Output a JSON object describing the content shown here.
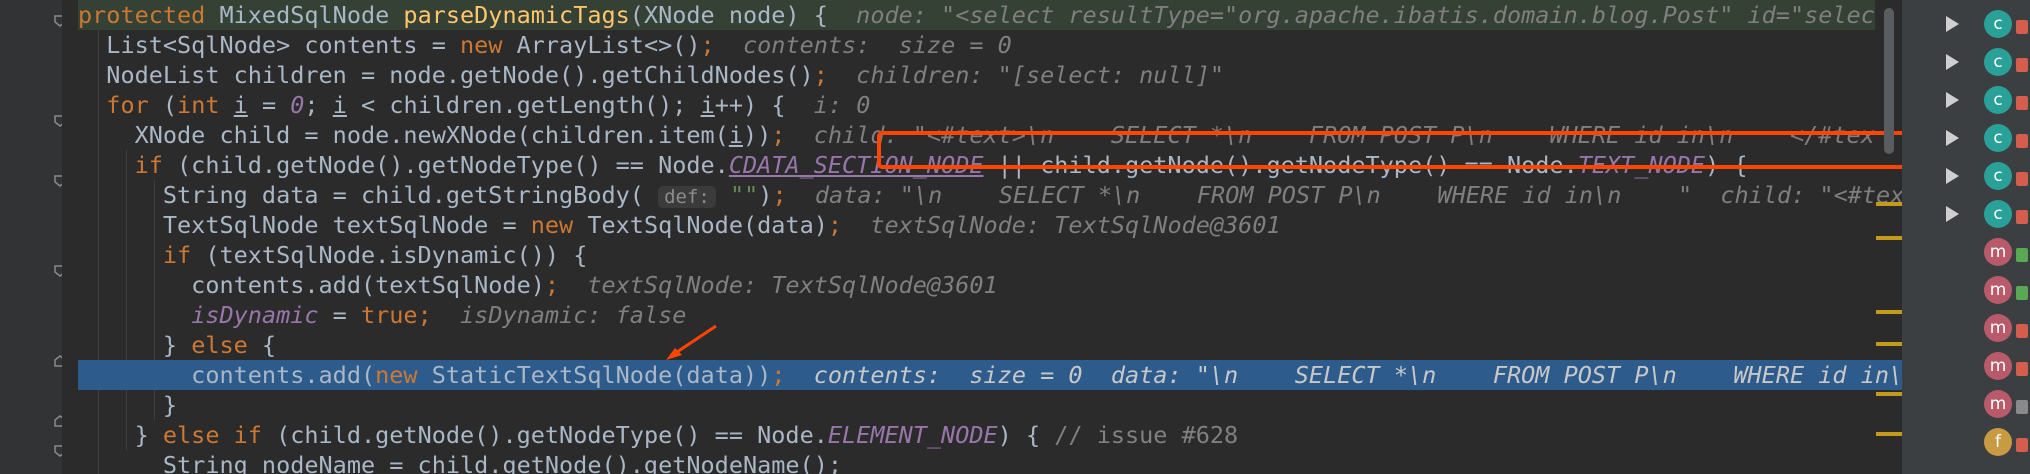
{
  "code_lines": [
    {
      "segments": [
        {
          "text": "protected",
          "cls": "kw"
        },
        {
          "text": " MixedSqlNode "
        },
        {
          "text": "parseDynamicTags",
          "cls": "fn"
        },
        {
          "text": "(XNode node) {  "
        },
        {
          "text": "node: \"<select resultType=\"org.apache.ibatis.domain.blog.Post\" id=\"selec",
          "cls": "hint"
        }
      ]
    },
    {
      "segments": [
        {
          "text": "  List<SqlNode> contents = "
        },
        {
          "text": "new",
          "cls": "kw"
        },
        {
          "text": " ArrayList<>()"
        },
        {
          "text": ";",
          "cls": "kw"
        },
        {
          "text": "  contents:  size = 0",
          "cls": "hint"
        }
      ]
    },
    {
      "segments": [
        {
          "text": "  NodeList children = node.getNode().getChildNodes()"
        },
        {
          "text": ";",
          "cls": "kw"
        },
        {
          "text": "  children: \"[select: null]\"",
          "cls": "hint"
        }
      ]
    },
    {
      "segments": [
        {
          "text": "  "
        },
        {
          "text": "for",
          "cls": "kw"
        },
        {
          "text": " ("
        },
        {
          "text": "int",
          "cls": "kw"
        },
        {
          "text": " "
        },
        {
          "text": "i",
          "cls": "ul"
        },
        {
          "text": " = "
        },
        {
          "text": "0",
          "cls": "cn"
        },
        {
          "text": "; "
        },
        {
          "text": "i",
          "cls": "ul"
        },
        {
          "text": " < children.getLength(); "
        },
        {
          "text": "i",
          "cls": "ul"
        },
        {
          "text": "++) {  "
        },
        {
          "text": "i: 0",
          "cls": "hint"
        }
      ]
    },
    {
      "segments": [
        {
          "text": "    XNode child = node.newXNode(children.item("
        },
        {
          "text": "i",
          "cls": "ul"
        },
        {
          "text": "))"
        },
        {
          "text": ";",
          "cls": "kw"
        },
        {
          "text": "  child: \"<#text>\\n    SELECT *\\n    FROM POST P\\n    WHERE id in\\n    </#tex",
          "cls": "hint"
        }
      ]
    },
    {
      "segments": [
        {
          "text": "    "
        },
        {
          "text": "if",
          "cls": "kw"
        },
        {
          "text": " (child.getNode().getNodeType() == Node."
        },
        {
          "text": "CDATA_SECTION_NODE",
          "cls": "cn ul"
        },
        {
          "text": " || child.getNode().getNodeType() == Node."
        },
        {
          "text": "TEXT_NODE",
          "cls": "cn"
        },
        {
          "text": ") {"
        }
      ]
    },
    {
      "segments": [
        {
          "text": "      String data = child.getStringBody( "
        },
        {
          "text": "def:",
          "cls": "param-hint"
        },
        {
          "text": " "
        },
        {
          "text": "\"\"",
          "cls": "str"
        },
        {
          "text": ")"
        },
        {
          "text": ";",
          "cls": "kw"
        },
        {
          "text": "  data: \"\\n    SELECT *\\n    FROM POST P\\n    WHERE id in\\n    \"  child: \"<#text",
          "cls": "hint"
        }
      ]
    },
    {
      "segments": [
        {
          "text": "      TextSqlNode textSqlNode = "
        },
        {
          "text": "new",
          "cls": "kw"
        },
        {
          "text": " TextSqlNode(data)"
        },
        {
          "text": ";",
          "cls": "kw"
        },
        {
          "text": "  textSqlNode: TextSqlNode@3601",
          "cls": "hint"
        }
      ]
    },
    {
      "segments": [
        {
          "text": "      "
        },
        {
          "text": "if",
          "cls": "kw"
        },
        {
          "text": " (textSqlNode.isDynamic()) {"
        }
      ]
    },
    {
      "segments": [
        {
          "text": "        contents.add(textSqlNode)"
        },
        {
          "text": ";",
          "cls": "kw"
        },
        {
          "text": "  textSqlNode: TextSqlNode@3601",
          "cls": "hint"
        }
      ]
    },
    {
      "segments": [
        {
          "text": "        "
        },
        {
          "text": "isDynamic",
          "cls": "cn"
        },
        {
          "text": " = "
        },
        {
          "text": "true",
          "cls": "kw"
        },
        {
          "text": ";",
          "cls": "kw"
        },
        {
          "text": "  isDynamic: false",
          "cls": "hint"
        }
      ]
    },
    {
      "segments": [
        {
          "text": "      } "
        },
        {
          "text": "else",
          "cls": "kw"
        },
        {
          "text": " {"
        }
      ]
    },
    {
      "segments": [
        {
          "text": "        contents.add("
        },
        {
          "text": "new",
          "cls": "kw"
        },
        {
          "text": " StaticTextSqlNode(data))"
        },
        {
          "text": ";",
          "cls": "kw"
        },
        {
          "text": "  contents:  size = 0  data: \"\\n    SELECT *\\n    FROM POST P\\n    WHERE id in\\",
          "cls": "hint"
        }
      ]
    },
    {
      "segments": [
        {
          "text": "      }"
        }
      ]
    },
    {
      "segments": [
        {
          "text": "    } "
        },
        {
          "text": "else if",
          "cls": "kw"
        },
        {
          "text": " (child.getNode().getNodeType() == Node."
        },
        {
          "text": "ELEMENT_NODE",
          "cls": "cn"
        },
        {
          "text": ") { "
        },
        {
          "text": "// issue #628",
          "cls": "cm"
        }
      ]
    },
    {
      "segments": [
        {
          "text": "      String nodeName = child.getNode().getNodeName();"
        }
      ]
    }
  ],
  "structure": [
    {
      "badge": "c",
      "lock": "red",
      "expandable": true
    },
    {
      "badge": "c",
      "lock": "red",
      "expandable": true
    },
    {
      "badge": "c",
      "lock": "red",
      "expandable": true
    },
    {
      "badge": "c",
      "lock": "red",
      "expandable": true
    },
    {
      "badge": "c",
      "lock": "red",
      "expandable": true
    },
    {
      "badge": "c",
      "lock": "red",
      "expandable": true
    },
    {
      "badge": "m",
      "lock": "green",
      "expandable": false
    },
    {
      "badge": "m",
      "lock": "green",
      "expandable": false
    },
    {
      "badge": "m",
      "lock": "red",
      "expandable": false
    },
    {
      "badge": "m",
      "lock": "red",
      "expandable": false
    },
    {
      "badge": "m",
      "lock": "grey",
      "expandable": false
    },
    {
      "badge": "f",
      "lock": "red",
      "expandable": false
    }
  ],
  "colors": {
    "editor_bg": "#2b2b2b",
    "execution_line": "#2d5b8c",
    "annotation": "#ff4500",
    "keyword": "#cc7832",
    "method": "#ffc66d",
    "constant": "#9876aa"
  }
}
